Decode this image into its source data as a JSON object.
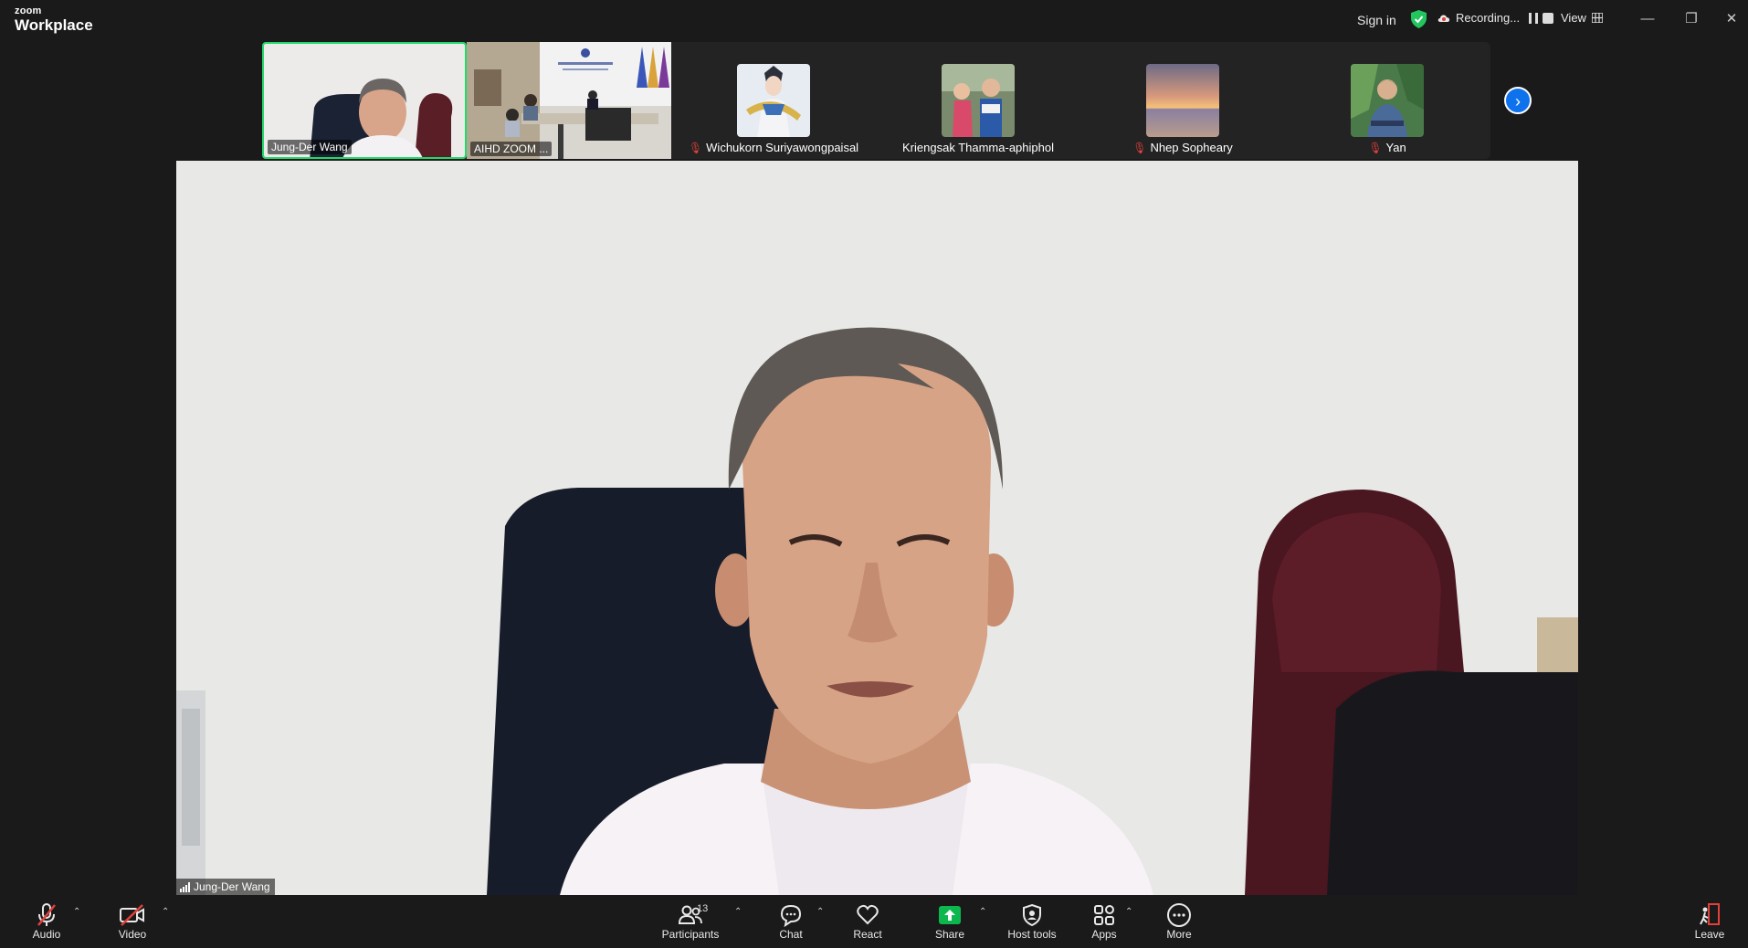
{
  "app": {
    "logo_line1": "zoom",
    "logo_line2": "Workplace"
  },
  "titlebar": {
    "sign_in": "Sign in",
    "recording_label": "Recording...",
    "view_label": "View",
    "window_controls": [
      "minimize-icon",
      "restore-icon",
      "close-icon"
    ]
  },
  "thumbnails": [
    {
      "name": "Jung-Der Wang",
      "type": "video",
      "active": true,
      "muted": false
    },
    {
      "name": "AIHD ZOOM ...",
      "type": "video",
      "active": false,
      "muted": false
    },
    {
      "name": "Wichukorn Suriyawongpaisal",
      "type": "avatar",
      "muted": true
    },
    {
      "name": "Kriengsak Thamma-aphiphol",
      "type": "avatar",
      "muted": false
    },
    {
      "name": "Nhep Sopheary",
      "type": "avatar",
      "muted": true
    },
    {
      "name": "Yan",
      "type": "avatar",
      "muted": true
    }
  ],
  "main_video": {
    "speaker_name": "Jung-Der Wang"
  },
  "toolbar": {
    "audio": "Audio",
    "video": "Video",
    "participants": "Participants",
    "participants_count": "13",
    "chat": "Chat",
    "react": "React",
    "share": "Share",
    "host_tools": "Host tools",
    "apps": "Apps",
    "more": "More",
    "leave": "Leave"
  },
  "colors": {
    "background": "#1a1a1a",
    "active_border": "#23d96b",
    "share_green": "#0cb84e",
    "recording_shield": "#22c55e",
    "next_button": "#0e72ed",
    "muted_red": "#e0413b"
  }
}
